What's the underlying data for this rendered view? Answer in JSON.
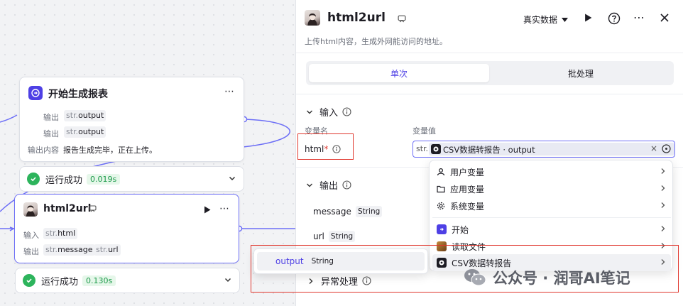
{
  "start_node": {
    "title": "开始生成报表",
    "rows": [
      {
        "label": "输出",
        "prefix": "str.",
        "value": "output"
      },
      {
        "label": "输出",
        "prefix": "str.",
        "value": "output"
      }
    ],
    "content_label": "输出内容",
    "content_value": "报告生成完毕，正在上传。",
    "status": "运行成功",
    "time": "0.019s"
  },
  "html_node": {
    "title": "html2url",
    "input_label": "输入",
    "input_prefix": "str.",
    "input_value": "html",
    "output_label": "输出",
    "outputs": [
      {
        "prefix": "str.",
        "value": "message"
      },
      {
        "prefix": "str.",
        "value": "url"
      }
    ],
    "status": "运行成功",
    "time": "0.130s"
  },
  "panel": {
    "title": "html2url",
    "data_mode": "真实数据",
    "description": "上传html内容，生成外网能访问的地址。",
    "tabs": [
      "单次",
      "批处理"
    ],
    "input_section": "输入",
    "col_name": "变量名",
    "col_value": "变量值",
    "input_var": "html",
    "required_mark": "*",
    "value_prefix": "str.",
    "value_ref": "CSV数据转报告 · output",
    "output_section": "输出",
    "outputs": [
      {
        "name": "message",
        "type": "String"
      },
      {
        "name": "url",
        "type": "String"
      }
    ],
    "exception_section": "异常处理"
  },
  "dropdown": {
    "items": [
      "用户变量",
      "应用变量",
      "系统变量"
    ],
    "nodes": [
      "开始",
      "读取文件",
      "CSV数据转报告"
    ]
  },
  "popup": {
    "name": "output",
    "type": "String"
  },
  "watermark": "公众号 · 润哥AI笔记",
  "colors": {
    "accent": "#4e40e5",
    "success": "#2db45c",
    "highlight": "#e0362d"
  }
}
